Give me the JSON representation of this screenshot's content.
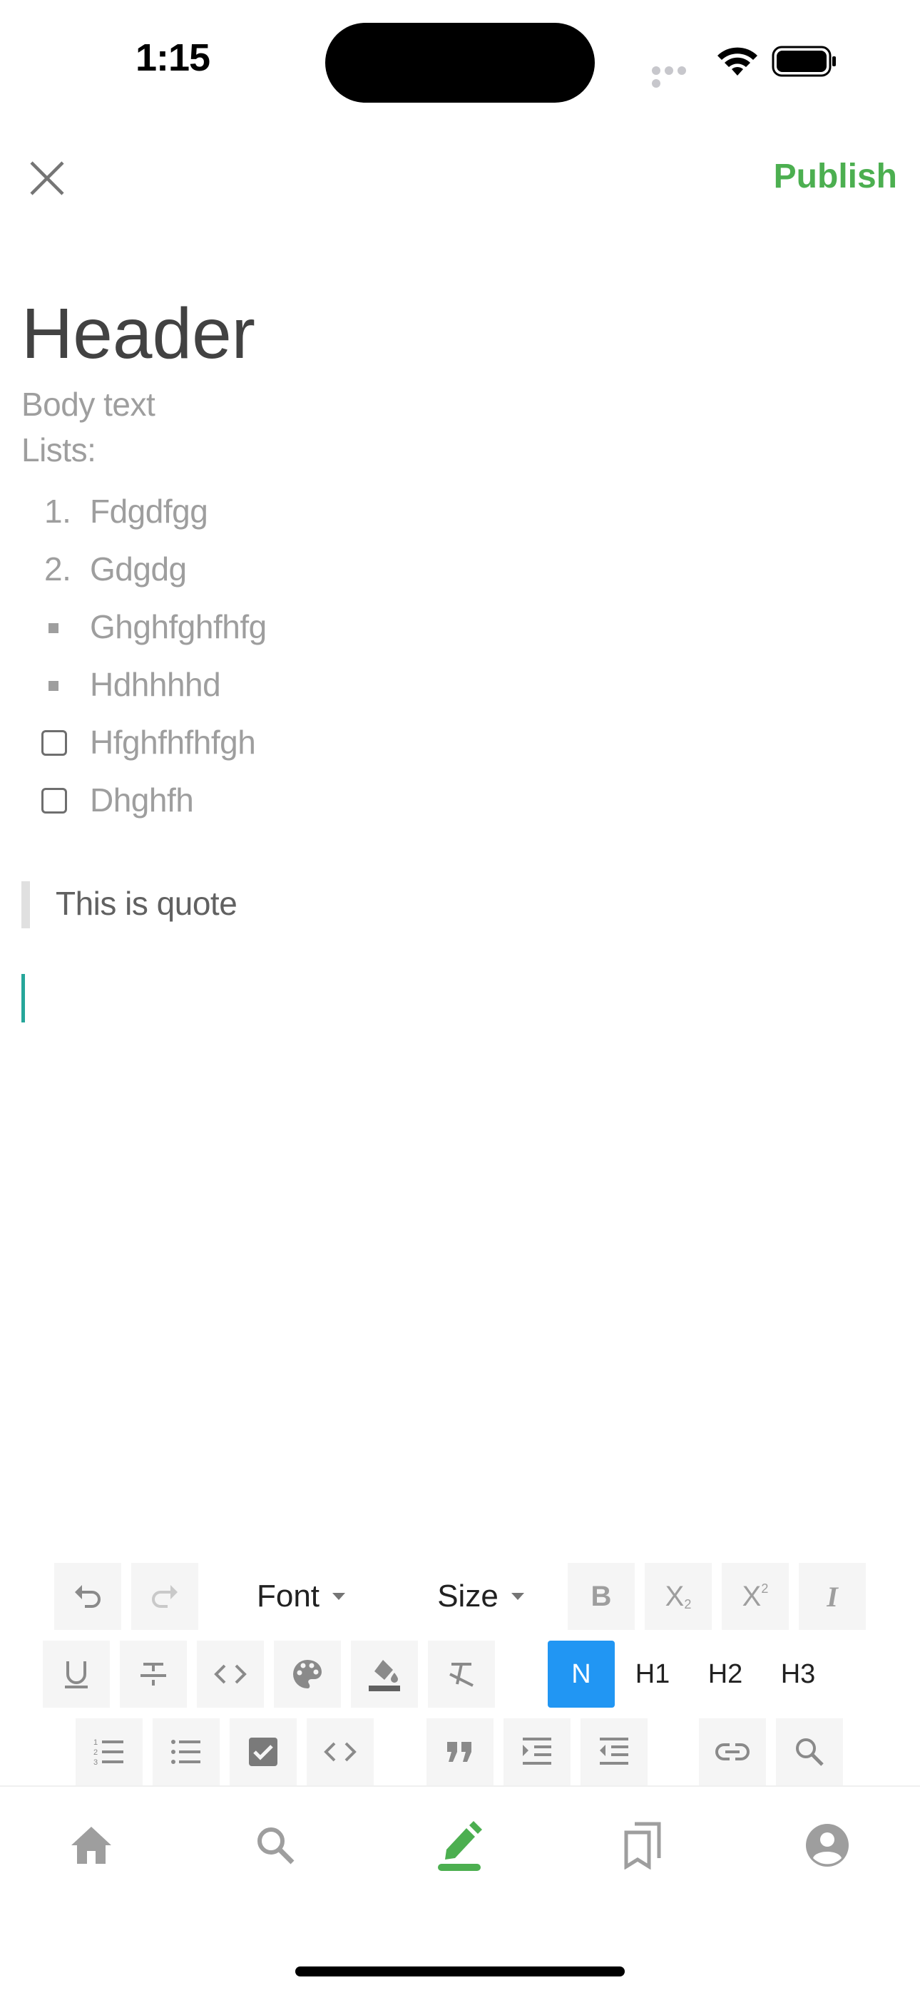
{
  "status_bar": {
    "time": "1:15"
  },
  "top_bar": {
    "publish_label": "Publish",
    "close_icon": "close-icon"
  },
  "editor": {
    "header": "Header",
    "body": "Body text",
    "lists_label": "Lists:",
    "ordered_items": [
      {
        "marker": "1.",
        "text": "Fdgdfgg"
      },
      {
        "marker": "2.",
        "text": "Gdgdg"
      }
    ],
    "bullet_items": [
      "Ghghfghfhfg",
      "Hdhhhhd"
    ],
    "checklist_items": [
      "Hfghfhfhfgh",
      "Dhghfh"
    ],
    "quote": "This is quote"
  },
  "toolbar": {
    "font_label": "Font",
    "size_label": "Size",
    "bold_label": "B",
    "subscript_label": "X",
    "superscript_label": "X",
    "italic_label": "I",
    "normal_label": "N",
    "h1_label": "H1",
    "h2_label": "H2",
    "h3_label": "H3",
    "active_format": "N"
  },
  "tabs": [
    {
      "icon": "home-icon",
      "active": false
    },
    {
      "icon": "search-icon",
      "active": false
    },
    {
      "icon": "edit-icon",
      "active": true
    },
    {
      "icon": "bookmarks-icon",
      "active": false
    },
    {
      "icon": "profile-icon",
      "active": false
    }
  ],
  "colors": {
    "accent": "#4caf50",
    "active_heading": "#2196f3",
    "cursor": "#26a69a",
    "muted_text": "#9e9e9e"
  }
}
